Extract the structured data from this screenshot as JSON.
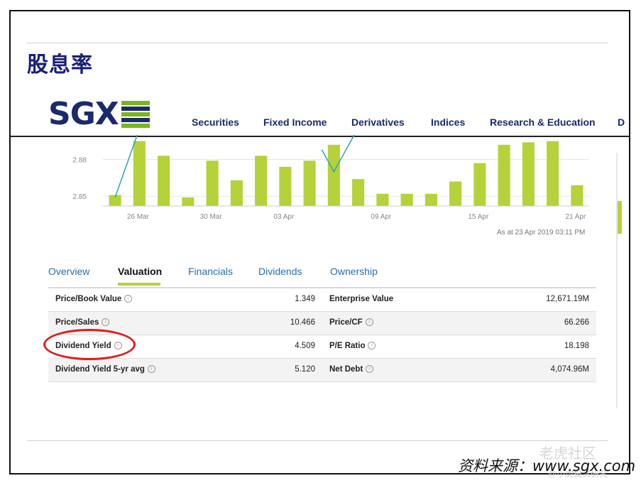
{
  "slide": {
    "title": "股息率",
    "source": "资料来源：www.sgx.com",
    "watermark": "老虎社区",
    "watermark_sub": "@小虎投资研究"
  },
  "logo": {
    "text": "SGX",
    "colors": [
      "#7ab51d",
      "#1a2a6c"
    ]
  },
  "nav": {
    "items": [
      "Securities",
      "Fixed Income",
      "Derivatives",
      "Indices",
      "Research & Education",
      "D"
    ]
  },
  "chart_data": {
    "type": "bar",
    "y_ticks": [
      "2.88",
      "2.85"
    ],
    "x_ticks": [
      "26 Mar",
      "30 Mar",
      "03 Apr",
      "09 Apr",
      "15 Apr",
      "21 Apr"
    ],
    "values": [
      2.851,
      2.895,
      2.883,
      2.849,
      2.879,
      2.863,
      2.883,
      2.874,
      2.879,
      2.892,
      2.864,
      2.852,
      2.852,
      2.852,
      2.862,
      2.877,
      2.892,
      2.894,
      2.895,
      2.859
    ],
    "line": [
      2.849,
      2.888,
      2.888,
      2.87,
      2.889
    ],
    "ylim": [
      2.842,
      2.9
    ],
    "bar_color": "#b5d23b",
    "line_color": "#2aa3b8",
    "as_at": "As at 23 Apr 2019 03:11 PM"
  },
  "tabs": {
    "items": [
      "Overview",
      "Valuation",
      "Financials",
      "Dividends",
      "Ownership"
    ],
    "active": "Valuation"
  },
  "valuation_table": {
    "rows": [
      {
        "left_label": "Price/Book Value",
        "left_value": "1.349",
        "right_label": "Enterprise Value",
        "right_value": "12,671.19M"
      },
      {
        "left_label": "Price/Sales",
        "left_value": "10.466",
        "right_label": "Price/CF",
        "right_value": "66.266"
      },
      {
        "left_label": "Dividend Yield",
        "left_value": "4.509",
        "right_label": "P/E Ratio",
        "right_value": "18.198"
      },
      {
        "left_label": "Dividend Yield 5-yr avg",
        "left_value": "5.120",
        "right_label": "Net Debt",
        "right_value": "4,074.96M"
      }
    ],
    "info_glyph": "i"
  }
}
